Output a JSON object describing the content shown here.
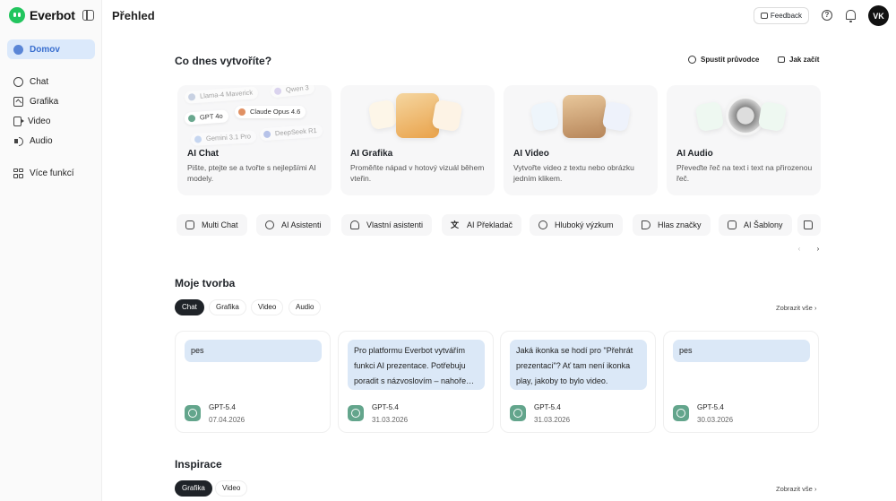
{
  "app": {
    "name": "Everbot"
  },
  "sidebar": {
    "items": [
      {
        "label": "Domov",
        "icon": "home-icon",
        "active": true
      },
      {
        "label": "Chat",
        "icon": "chat-icon"
      },
      {
        "label": "Grafika",
        "icon": "image-icon"
      },
      {
        "label": "Video",
        "icon": "video-icon"
      },
      {
        "label": "Audio",
        "icon": "audio-icon"
      },
      {
        "label": "Více funkcí",
        "icon": "more-icon"
      }
    ]
  },
  "header": {
    "title": "Přehled",
    "feedback_label": "Feedback",
    "avatar_initials": "VK"
  },
  "create": {
    "heading": "Co dnes vytvoříte?",
    "guide_label": "Spustit průvodce",
    "howto_label": "Jak začít",
    "cards": [
      {
        "title": "AI Chat",
        "desc": "Pište, ptejte se a tvořte s nejlepšími AI modely.",
        "models": [
          "Llama-4 Maverick",
          "Qwen 3",
          "GPT 4o",
          "Claude Opus 4.6",
          "Gemini 3.1 Pro",
          "DeepSeek R1"
        ]
      },
      {
        "title": "AI Grafika",
        "desc": "Proměňte nápad v hotový vizuál během vteřin."
      },
      {
        "title": "AI Video",
        "desc": "Vytvořte video z textu nebo obrázku jedním klikem."
      },
      {
        "title": "AI Audio",
        "desc": "Převeďte řeč na text i text na přirozenou řeč."
      }
    ]
  },
  "quick": {
    "chips": [
      "Multi Chat",
      "AI Asistenti",
      "Vlastní asistenti",
      "AI Překladač",
      "Hluboký výzkum",
      "Hlas značky",
      "AI Šablony"
    ],
    "prev": "‹",
    "next": "›"
  },
  "recent": {
    "heading": "Moje tvorba",
    "tabs": [
      "Chat",
      "Grafika",
      "Video",
      "Audio"
    ],
    "active_tab": "Chat",
    "see_all": "Zobrazit vše",
    "items": [
      {
        "text": "pes",
        "model": "GPT-5.4",
        "date": "07.04.2026"
      },
      {
        "text": "Pro platformu Everbot vytvářím funkci AI prezentace. Potřebuju poradit s názvoslovím – nahoře…",
        "model": "GPT-5.4",
        "date": "31.03.2026"
      },
      {
        "text": "Jaká ikonka se hodí pro \"Přehrát prezentaci\"? Ať tam není ikonka play, jakoby to bylo video.",
        "model": "GPT-5.4",
        "date": "31.03.2026"
      },
      {
        "text": "pes",
        "model": "GPT-5.4",
        "date": "30.03.2026"
      }
    ]
  },
  "inspiration": {
    "heading": "Inspirace",
    "tabs": [
      "Grafika",
      "Video"
    ],
    "active_tab": "Grafika",
    "see_all": "Zobrazit vše"
  }
}
